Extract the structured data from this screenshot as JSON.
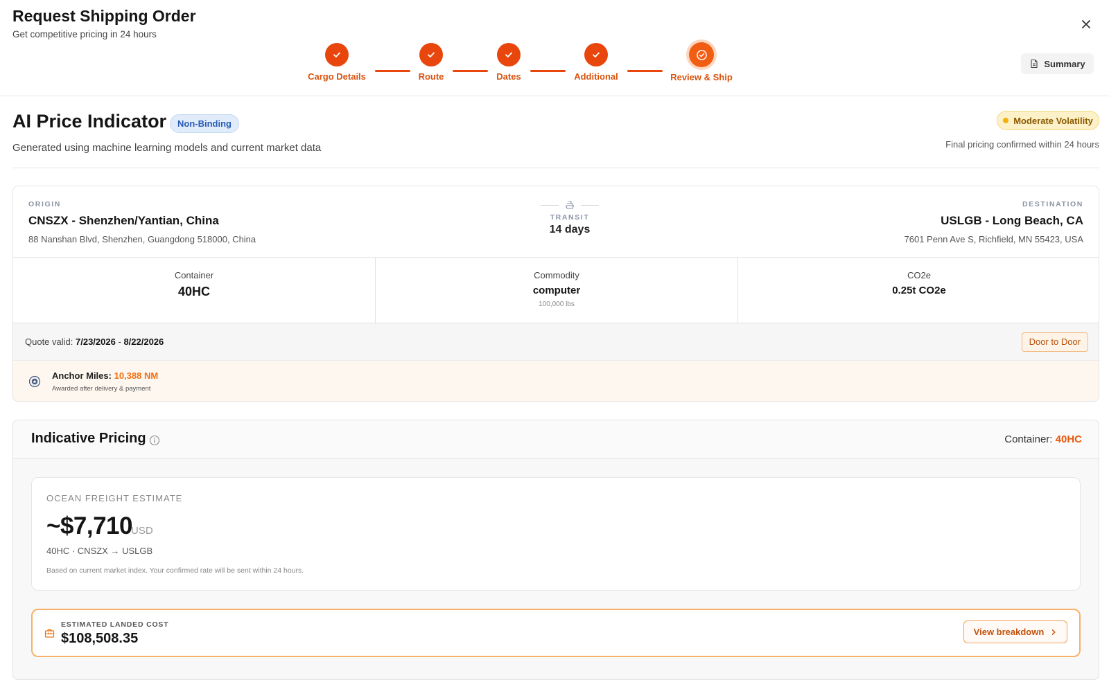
{
  "header": {
    "title": "Request Shipping Order",
    "subtitle": "Get competitive pricing in 24 hours",
    "summary_label": "Summary"
  },
  "steps": [
    {
      "label": "Cargo Details",
      "state": "complete"
    },
    {
      "label": "Route",
      "state": "complete"
    },
    {
      "label": "Dates",
      "state": "complete"
    },
    {
      "label": "Additional",
      "state": "complete"
    },
    {
      "label": "Review & Ship",
      "state": "active"
    }
  ],
  "price_indicator": {
    "title": "AI Price Indicator",
    "badge": "Non-Binding",
    "description": "Generated using machine learning models and current market data",
    "volatility": "Moderate Volatility",
    "final_note": "Final pricing confirmed within 24 hours"
  },
  "route": {
    "origin_label": "ORIGIN",
    "origin_name": "CNSZX - Shenzhen/Yantian, China",
    "origin_address": "88 Nanshan Blvd, Shenzhen, Guangdong 518000, China",
    "transit_label": "TRANSIT",
    "transit_value": "14 days",
    "destination_label": "DESTINATION",
    "destination_name": "USLGB - Long Beach, CA",
    "destination_address": "7601 Penn Ave S, Richfield, MN 55423, USA"
  },
  "stats": {
    "container_label": "Container",
    "container_value": "40HC",
    "commodity_label": "Commodity",
    "commodity_value": "computer",
    "commodity_weight": "100,000 lbs",
    "co2_label": "CO2e",
    "co2_value": "0.25t CO2e"
  },
  "quote": {
    "prefix": "Quote valid:",
    "start": "7/23/2026",
    "separator": "-",
    "end": "8/22/2026",
    "service_badge": "Door to Door"
  },
  "miles": {
    "label": "Anchor Miles:",
    "value": "10,388 NM",
    "note": "Awarded after delivery & payment"
  },
  "pricing": {
    "title": "Indicative Pricing",
    "container_label": "Container:",
    "container_value": "40HC",
    "freight_label": "OCEAN FREIGHT ESTIMATE",
    "freight_price": "~$7,710",
    "freight_currency": "USD",
    "freight_route": "40HC · CNSZX → USLGB",
    "freight_note": "Based on current market index. Your confirmed rate will be sent within 24 hours.",
    "landed_label": "ESTIMATED LANDED COST",
    "landed_value": "$108,508.35",
    "breakdown_label": "View breakdown"
  },
  "colors": {
    "accent": "#e8460c",
    "accent_text": "#d8530f",
    "badge_blue": "#2a5bb5",
    "volatility_yellow": "#f2b20b",
    "miles_orange": "#f26f12"
  },
  "icons": [
    "close-icon",
    "check-icon",
    "target-check-icon",
    "document-icon",
    "ship-icon",
    "medal-icon",
    "info-icon",
    "briefcase-icon",
    "chevron-right-icon"
  ]
}
